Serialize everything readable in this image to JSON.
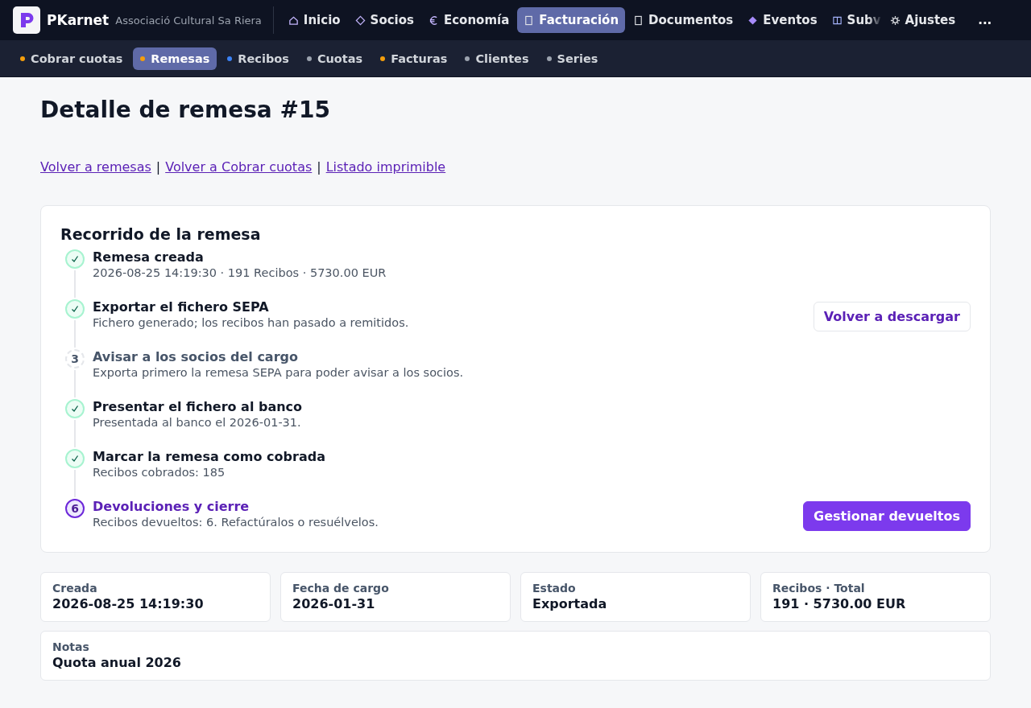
{
  "brand": {
    "name": "PKarnet",
    "org": "Associació Cultural Sa Riera"
  },
  "nav": [
    {
      "label": "Inicio",
      "selected": false
    },
    {
      "label": "Socios",
      "selected": false
    },
    {
      "label": "Economía",
      "selected": false
    },
    {
      "label": "Facturación",
      "selected": true
    },
    {
      "label": "Documentos",
      "selected": false
    },
    {
      "label": "Eventos",
      "selected": false
    },
    {
      "label": "Subv",
      "selected": false
    },
    {
      "label": "Ajustes",
      "selected": false
    }
  ],
  "nav_more": "...",
  "subnav": [
    {
      "label": "Cobrar cuotas",
      "selected": false,
      "color": "#f59e0b"
    },
    {
      "label": "Remesas",
      "selected": true,
      "color": "#f59e0b"
    },
    {
      "label": "Recibos",
      "selected": false,
      "color": "#3b82f6"
    },
    {
      "label": "Cuotas",
      "selected": false,
      "color": "#9ca3af"
    },
    {
      "label": "Facturas",
      "selected": false,
      "color": "#f59e0b"
    },
    {
      "label": "Clientes",
      "selected": false,
      "color": "#9ca3af"
    },
    {
      "label": "Series",
      "selected": false,
      "color": "#9ca3af"
    }
  ],
  "title": "Detalle de remesa #15",
  "links": [
    "Volver a remesas",
    "Volver a Cobrar cuotas",
    "Listado imprimible"
  ],
  "link_separator": "|",
  "timeline": {
    "title": "Recorrido de la remesa",
    "steps": [
      {
        "kind": "done",
        "title": "Remesa creada",
        "detail": "2026-08-25 14:19:30 · 191 Recibos · 5730.00 EUR"
      },
      {
        "kind": "done",
        "title": "Exportar el fichero SEPA",
        "detail": "Fichero generado; los recibos han pasado a remitidos.",
        "action": {
          "label": "Volver a descargar",
          "primary": false
        }
      },
      {
        "kind": "pending",
        "number": "3",
        "title": "Avisar a los socios del cargo",
        "detail": "Exporta primero la remesa SEPA para poder avisar a los socios."
      },
      {
        "kind": "done",
        "title": "Presentar el fichero al banco",
        "detail": "Presentada al banco el 2026-01-31."
      },
      {
        "kind": "done",
        "title": "Marcar la remesa como cobrada",
        "detail": "Recibos cobrados: 185"
      },
      {
        "kind": "current",
        "number": "6",
        "title": "Devoluciones y cierre",
        "detail": "Recibos devueltos: 6. Refactúralos o resuélvelos.",
        "action": {
          "label": "Gestionar devueltos",
          "primary": true
        }
      }
    ]
  },
  "stats": [
    {
      "label": "Creada",
      "value": "2026-08-25 14:19:30"
    },
    {
      "label": "Fecha de cargo",
      "value": "2026-01-31"
    },
    {
      "label": "Estado",
      "value": "Exportada"
    },
    {
      "label": "Recibos · Total",
      "value": "191 · 5730.00 EUR"
    }
  ],
  "notes": {
    "label": "Notas",
    "value": "Quota anual 2026"
  }
}
